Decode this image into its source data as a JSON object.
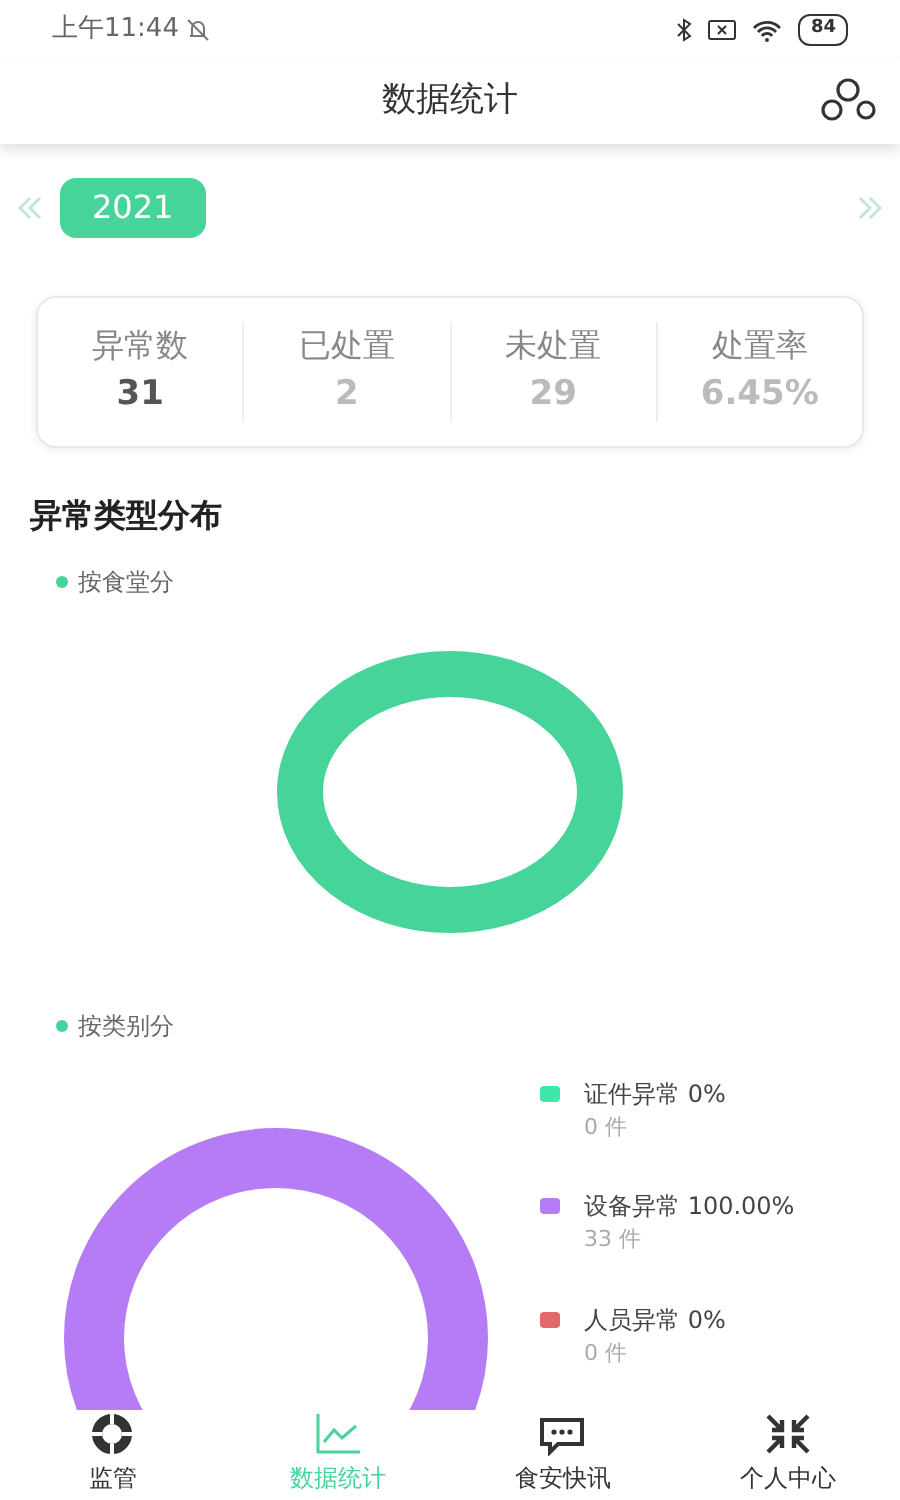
{
  "status_bar": {
    "time": "上午11:44",
    "battery": "84"
  },
  "header": {
    "title": "数据统计"
  },
  "year_selector": {
    "year": "2021"
  },
  "stats": [
    {
      "label": "异常数",
      "value": "31",
      "emphasized": true
    },
    {
      "label": "已处置",
      "value": "2",
      "emphasized": false
    },
    {
      "label": "未处置",
      "value": "29",
      "emphasized": false
    },
    {
      "label": "处置率",
      "value": "6.45%",
      "emphasized": false
    }
  ],
  "section": {
    "title": "异常类型分布"
  },
  "by_canteen": {
    "label": "按食堂分",
    "color": "#46d49a"
  },
  "by_category": {
    "label": "按类别分",
    "color": "#46d49a",
    "legend": [
      {
        "label": "证件异常 0%",
        "count": "0 件",
        "color": "#3ee8a8"
      },
      {
        "label": "设备异常 100.00%",
        "count": "33 件",
        "color": "#b57cf5"
      },
      {
        "label": "人员异常 0%",
        "count": "0 件",
        "color": "#e06a6a"
      }
    ]
  },
  "tabs": [
    {
      "label": "监管",
      "selected": false,
      "kind": "ring"
    },
    {
      "label": "数据统计",
      "selected": true,
      "kind": "chart"
    },
    {
      "label": "食安快讯",
      "selected": false,
      "kind": "message"
    },
    {
      "label": "个人中心",
      "selected": false,
      "kind": "shrink"
    }
  ]
}
